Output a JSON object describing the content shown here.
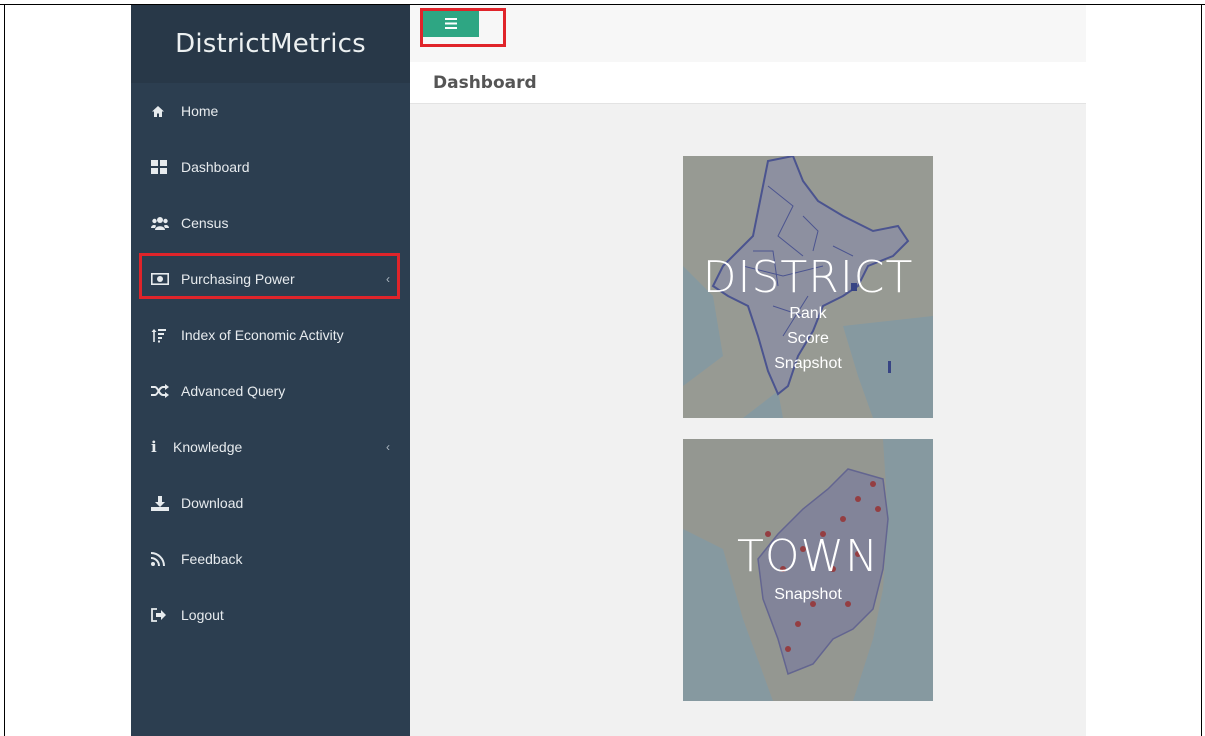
{
  "brand": {
    "title": "DistrictMetrics"
  },
  "sidebar": {
    "items": [
      {
        "label": "Home",
        "icon": "home-icon"
      },
      {
        "label": "Dashboard",
        "icon": "dashboard-icon"
      },
      {
        "label": "Census",
        "icon": "users-icon"
      },
      {
        "label": "Purchasing Power",
        "icon": "money-icon",
        "has_submenu": true
      },
      {
        "label": "Index of Economic Activity",
        "icon": "sort-icon"
      },
      {
        "label": "Advanced Query",
        "icon": "shuffle-icon"
      },
      {
        "label": "Knowledge",
        "icon": "info-icon",
        "has_submenu": true
      },
      {
        "label": "Download",
        "icon": "download-icon"
      },
      {
        "label": "Feedback",
        "icon": "rss-icon"
      },
      {
        "label": "Logout",
        "icon": "logout-icon"
      }
    ]
  },
  "topbar": {
    "menu_button_icon": "hamburger-icon"
  },
  "section": {
    "title": "Dashboard"
  },
  "tiles": [
    {
      "title": "DISTRICT",
      "lines": [
        "Rank",
        "Score",
        "Snapshot"
      ]
    },
    {
      "title": "TOWN",
      "lines": [
        "Snapshot"
      ]
    }
  ],
  "colors": {
    "sidebar_bg": "#2c3e50",
    "accent": "#2ea683",
    "highlight": "#e0242a"
  }
}
